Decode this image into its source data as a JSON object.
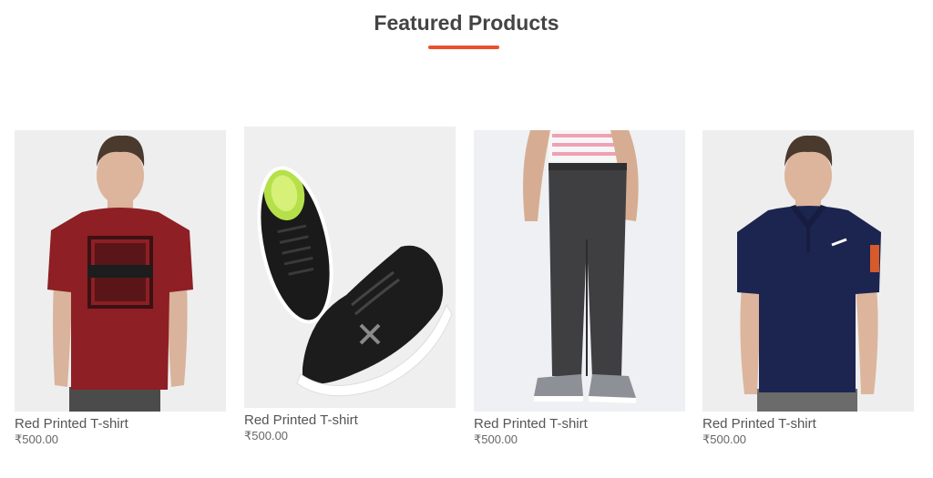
{
  "section": {
    "title": "Featured Products",
    "accent_color": "#e8502f"
  },
  "products": [
    {
      "name": "Red Printed T-shirt",
      "price": "₹500.00",
      "image": "model-red-printed-tshirt",
      "item_color": "#8e1f24"
    },
    {
      "name": "Red Printed T-shirt",
      "price": "₹500.00",
      "image": "black-running-shoes",
      "item_color": "#111111"
    },
    {
      "name": "Red Printed T-shirt",
      "price": "₹500.00",
      "image": "model-grey-joggers",
      "item_color": "#3f3f42"
    },
    {
      "name": "Red Printed T-shirt",
      "price": "₹500.00",
      "image": "model-navy-polo-shirt",
      "item_color": "#1c2550"
    }
  ]
}
